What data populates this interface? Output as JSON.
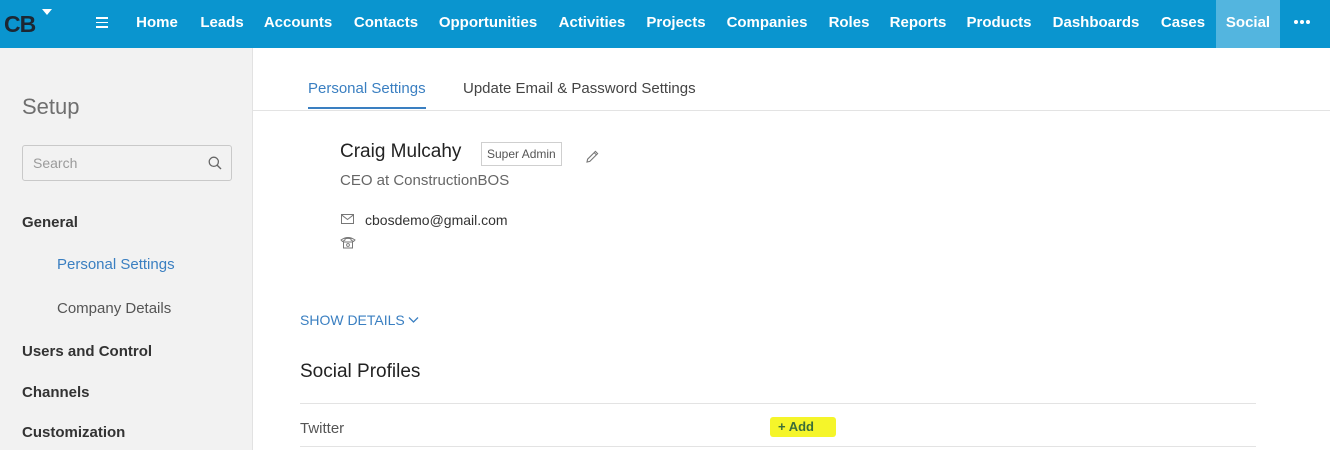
{
  "app": {
    "logo_text": "CB",
    "accent_color": "#0a95cf",
    "active_nav_color": "#53b5df"
  },
  "nav": {
    "items": [
      {
        "label": "Home"
      },
      {
        "label": "Leads"
      },
      {
        "label": "Accounts"
      },
      {
        "label": "Contacts"
      },
      {
        "label": "Opportunities"
      },
      {
        "label": "Activities"
      },
      {
        "label": "Projects"
      },
      {
        "label": "Companies"
      },
      {
        "label": "Roles"
      },
      {
        "label": "Reports"
      },
      {
        "label": "Products"
      },
      {
        "label": "Dashboards"
      },
      {
        "label": "Cases"
      },
      {
        "label": "Social"
      }
    ],
    "active": "Social",
    "more_icon": "more-dots-icon"
  },
  "sidebar": {
    "title": "Setup",
    "search_placeholder": "Search",
    "sections": [
      {
        "label": "General"
      },
      {
        "label": "Users and Control"
      },
      {
        "label": "Channels"
      },
      {
        "label": "Customization"
      }
    ],
    "general_items": [
      {
        "label": "Personal Settings",
        "active": true
      },
      {
        "label": "Company Details",
        "active": false
      }
    ]
  },
  "tabs": [
    {
      "label": "Personal Settings",
      "active": true
    },
    {
      "label": "Update Email & Password Settings",
      "active": false
    }
  ],
  "profile": {
    "name": "Craig Mulcahy",
    "role": "Super Admin",
    "title": "CEO at ConstructionBOS",
    "email": "cbosdemo@gmail.com"
  },
  "show_details_label": "SHOW DETAILS",
  "social": {
    "heading": "Social Profiles",
    "rows": [
      {
        "network": "Twitter",
        "action": "+ Add"
      }
    ]
  }
}
